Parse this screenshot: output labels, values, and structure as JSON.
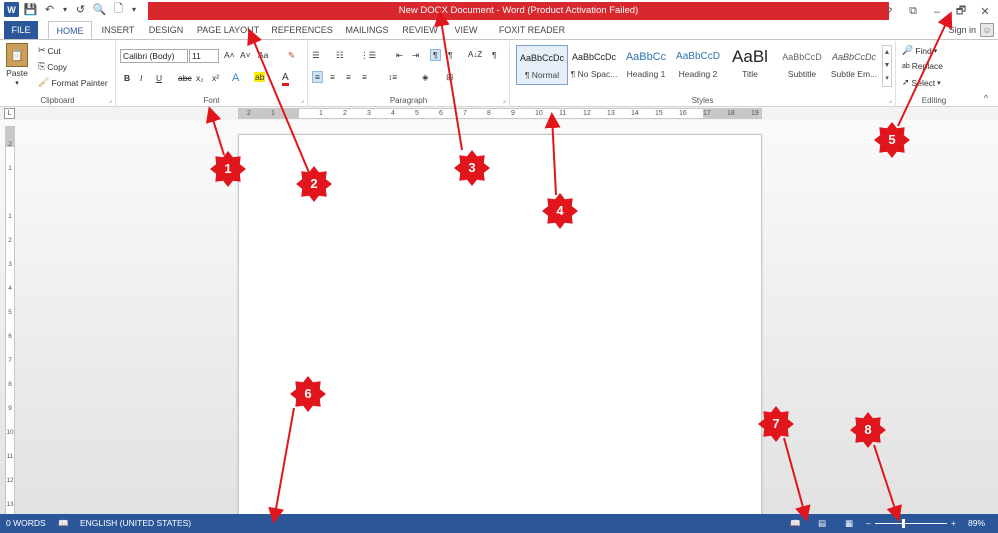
{
  "titlebar": {
    "title": "New DOCX Document - Word (Product Activation Failed)",
    "qat": {
      "app_icon": "W",
      "save_icon": "💾",
      "undo_icon": "↶",
      "undo_arrow": "▾",
      "redo_icon": "↺",
      "print_preview_icon": "🔍",
      "new_icon": "🗋",
      "customize_icon": "▾"
    },
    "controls": {
      "help": "?",
      "ribbon_options": "⧉",
      "minimize": "–",
      "restore": "🗗",
      "close": "✕"
    }
  },
  "tabs": [
    "FILE",
    "HOME",
    "INSERT",
    "DESIGN",
    "PAGE LAYOUT",
    "REFERENCES",
    "MAILINGS",
    "REVIEW",
    "VIEW",
    "FOXIT READER PDF"
  ],
  "signin": "Sign in",
  "ribbon": {
    "clipboard": {
      "label": "Clipboard",
      "paste": "Paste",
      "cut": "Cut",
      "copy": "Copy",
      "format_painter": "Format Painter"
    },
    "font": {
      "label": "Font",
      "font_name": "Calibri (Body)",
      "font_size": "11",
      "grow": "A˄",
      "shrink": "A˅",
      "case": "Aa",
      "clear": "✎",
      "bold": "B",
      "italic": "I",
      "underline": "U",
      "strike": "abc",
      "subscript": "x₂",
      "superscript": "x²",
      "effects": "A",
      "highlight": "ab",
      "color": "A"
    },
    "paragraph": {
      "label": "Paragraph",
      "bullets": "☰",
      "numbering": "☷",
      "multilevel": "⋮☰",
      "decrease_indent": "⇤",
      "increase_indent": "⇥",
      "ltr": "¶",
      "rtl": "¶",
      "sort": "A↓Z",
      "show_marks": "¶",
      "align_left": "≡",
      "center": "≡",
      "align_right": "≡",
      "justify": "≡",
      "line_spacing": "↕≡",
      "shading": "◈",
      "borders": "⊞"
    },
    "styles": {
      "label": "Styles",
      "items": [
        {
          "preview": "AaBbCcDc",
          "name": "¶ Normal"
        },
        {
          "preview": "AaBbCcDc",
          "name": "¶ No Spac..."
        },
        {
          "preview": "AaBbCc",
          "name": "Heading 1"
        },
        {
          "preview": "AaBbCcD",
          "name": "Heading 2"
        },
        {
          "preview": "AaBl",
          "name": "Title"
        },
        {
          "preview": "AaBbCcD",
          "name": "Subtitle"
        },
        {
          "preview": "AaBbCcDc",
          "name": "Subtle Em..."
        }
      ]
    },
    "editing": {
      "label": "Editing",
      "find": "Find",
      "replace": "Replace",
      "select": "Select"
    },
    "collapse": "^",
    "launcher": "⌟"
  },
  "ruler": {
    "corner": "L",
    "hticks": [
      "2",
      "1",
      "",
      "1",
      "2",
      "3",
      "4",
      "5",
      "6",
      "7",
      "8",
      "9",
      "10",
      "11",
      "12",
      "13",
      "14",
      "15",
      "16",
      "17",
      "18",
      "19"
    ],
    "vticks": [
      "2",
      "1",
      "",
      "1",
      "2",
      "3",
      "4",
      "5",
      "6",
      "7",
      "8",
      "9",
      "10",
      "11",
      "12",
      "13"
    ]
  },
  "status": {
    "words": "0 WORDS",
    "proofing_icon": "📖",
    "language": "ENGLISH (UNITED STATES)",
    "read_mode_icon": "📖",
    "print_layout_icon": "▤",
    "web_layout_icon": "▦",
    "zoom_minus": "–",
    "zoom_plus": "+",
    "zoom_level": "89%",
    "zoom_fraction": 0.39
  },
  "callouts": [
    "1",
    "2",
    "3",
    "4",
    "5",
    "6",
    "7",
    "8"
  ],
  "colors": {
    "word_blue": "#2b579a",
    "title_red": "#d9272e",
    "callout_red": "#e0161c"
  }
}
